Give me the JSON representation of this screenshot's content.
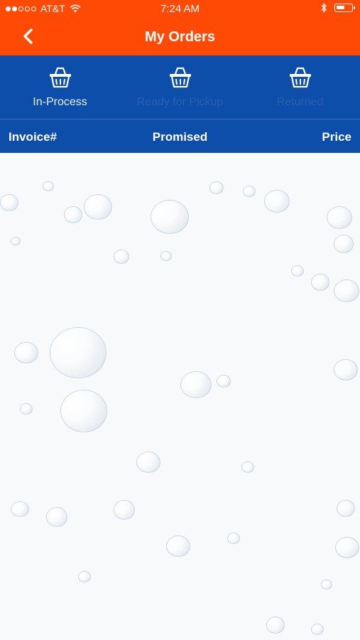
{
  "status_bar": {
    "carrier": "AT&T",
    "time": "7:24 AM"
  },
  "nav": {
    "title": "My Orders",
    "back_icon": "chevron-left-icon"
  },
  "tabs": [
    {
      "label": "In-Process",
      "icon": "basket-icon",
      "active": true
    },
    {
      "label": "Ready for Pickup",
      "icon": "basket-icon",
      "active": false
    },
    {
      "label": "Returned",
      "icon": "basket-icon",
      "active": false
    }
  ],
  "table": {
    "columns": [
      "Invoice#",
      "Promised",
      "Price"
    ],
    "rows": []
  },
  "colors": {
    "accent": "#ff4a06",
    "brand_blue": "#0c4eaa",
    "inactive_tab_text": "#2a5fb0"
  }
}
